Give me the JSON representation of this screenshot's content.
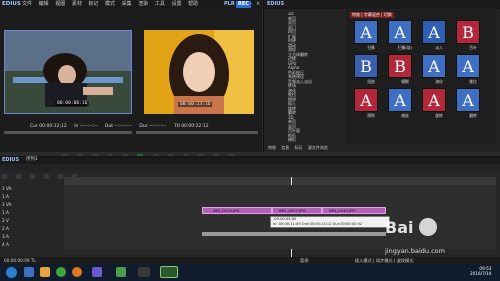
{
  "app": {
    "brand": "EDIUS",
    "mode_left": "PLR",
    "mode_right": "REC",
    "menu": [
      "文件",
      "编辑",
      "视图",
      "素材",
      "标记",
      "模式",
      "采集",
      "渲染",
      "工具",
      "设置",
      "帮助"
    ]
  },
  "player": {
    "left_timecode": "00:00:00:16",
    "right_timecode": "00:00:13:16",
    "info_row": [
      {
        "label": "Cur",
        "value": "00:00:12;12"
      },
      {
        "label": "In",
        "value": "--:--:--:--"
      },
      {
        "label": "Out",
        "value": "--:--:--:--"
      },
      {
        "label": "Dur",
        "value": "--:--:--:--"
      },
      {
        "label": "Ttl",
        "value": "00:00:22:12"
      }
    ]
  },
  "effects_panel": {
    "title": "EDIUS",
    "breadcrumb": "特效 | 字幕混合 | 切换",
    "tree": [
      "3D",
      "单页",
      "双页",
      "双门",
      "四页",
      "扩展",
      "时钟",
      "滑动",
      "滑轮",
      "立方体翻转",
      "边缘",
      "GPU",
      "Alpha",
      "色彩校正",
      "系统预设",
      "音频淡入淡出",
      "转场",
      "溶化",
      "推拉",
      "擦除",
      "插入",
      "旋转",
      "翻转",
      "3D",
      "单页",
      "双页",
      "百叶窗",
      "矩形",
      "梯形",
      "光栅",
      "圆形",
      "菱形",
      "十字"
    ],
    "tiles": [
      {
        "glyph": "A",
        "label": "扫像"
      },
      {
        "glyph": "A",
        "label": "扫像(软)"
      },
      {
        "glyph": "A",
        "label": "淡入"
      },
      {
        "glyph": "B",
        "label": "百叶"
      },
      {
        "glyph": "B",
        "label": "扭曲"
      },
      {
        "glyph": "B",
        "label": "模糊"
      },
      {
        "glyph": "A",
        "label": "溶化"
      },
      {
        "glyph": "A",
        "label": "推拉"
      },
      {
        "glyph": "A",
        "label": "擦除"
      },
      {
        "glyph": "A",
        "label": "缩放"
      },
      {
        "glyph": "A",
        "label": "旋转"
      },
      {
        "glyph": "A",
        "label": "翻转"
      }
    ],
    "tabs": [
      "特效",
      "信息",
      "标记",
      "源文件浏览"
    ]
  },
  "timeline": {
    "sequence_tab": "序列1",
    "tracks": [
      "1 VA",
      "1 A",
      "1 VA",
      "1 A",
      "2 V",
      "2 A",
      "3 A",
      "4 A"
    ],
    "clip_names": [
      "IMG_0013.JPG",
      "IMG_0017.JPG",
      "IMG_0040.JPG"
    ],
    "tooltip_line1": "-00:00:05:00",
    "tooltip_line2": "In: 00:00:11:09  Out:00:00:13:11  Dur:00:00:02:02",
    "status_left": "00:00:00:09 TL",
    "status_mid": "暂停",
    "status_right": "插入模式 | 同步模式 | 波纹模式"
  },
  "taskbar": {
    "clock_time": "09:53",
    "clock_date": "2016/7/14"
  },
  "watermark": {
    "text": "Bai",
    "url": "jingyan.baidu.com"
  }
}
